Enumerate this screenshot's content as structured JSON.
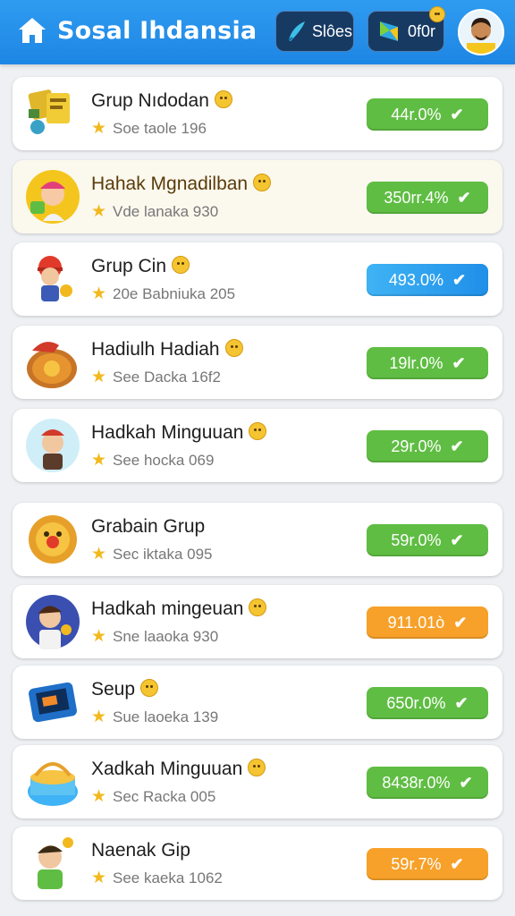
{
  "header": {
    "title": "Sosal Ihdansia",
    "slides_label": "Slôes",
    "count_label": "0f0r"
  },
  "items": [
    {
      "title": "Grup Nıdodan",
      "subtitle": "Soe taole 196",
      "value": "44r.0%",
      "status": "green"
    },
    {
      "title": "Hahak Mgnadilban",
      "subtitle": "Vde lanaka 930",
      "value": "350rr.4%",
      "status": "green"
    },
    {
      "title": "Grup Cin",
      "subtitle": "20e Babniuka 205",
      "value": "493.0%",
      "status": "blue"
    },
    {
      "title": "Hadiulh Hadiah",
      "subtitle": "See Dacka 16f2",
      "value": "19lr.0%",
      "status": "green"
    },
    {
      "title": "Hadkah Minguuan",
      "subtitle": "See hocka 069",
      "value": "29r.0%",
      "status": "green"
    },
    {
      "title": "Grabain Grup",
      "subtitle": "Sec iktaka 095",
      "value": "59r.0%",
      "status": "green"
    },
    {
      "title": "Hadkah mingeuan",
      "subtitle": "Sne laaoka 930",
      "value": "911.01ò",
      "status": "orange"
    },
    {
      "title": "Seup",
      "subtitle": "Sue laoeka 139",
      "value": "650r.0%",
      "status": "green"
    },
    {
      "title": "Xadkah Minguuan",
      "subtitle": "Sec Racka 005",
      "value": "8438r.0%",
      "status": "green"
    },
    {
      "title": "Naenak Gip",
      "subtitle": "See kaeka 1062",
      "value": "59r.7%",
      "status": "orange"
    }
  ],
  "colors": {
    "header": "#1d86e4",
    "green": "#5fbd43",
    "blue": "#1f8fe8",
    "orange": "#f7a12a"
  },
  "icons": [
    "home-icon",
    "pen-icon",
    "flag-icon",
    "star-icon",
    "check-icon",
    "emoji-icon"
  ]
}
